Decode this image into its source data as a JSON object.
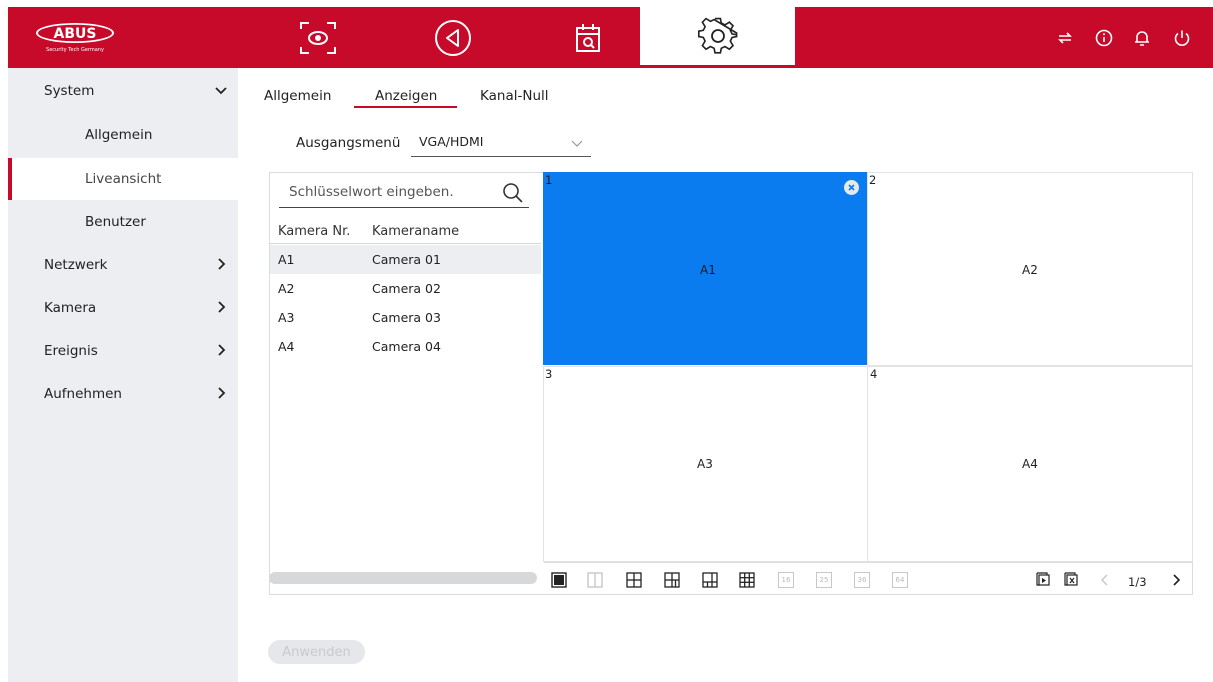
{
  "logo": {
    "brand": "ABUS",
    "tagline": "Security Tech Germany"
  },
  "topbar": {
    "icons": [
      "live-view-icon",
      "playback-icon",
      "schedule-search-icon",
      "settings-icon"
    ],
    "right_icons": [
      "swap-icon",
      "info-icon",
      "bell-icon",
      "power-icon"
    ]
  },
  "sidebar": {
    "items": [
      {
        "label": "System"
      },
      {
        "label": "Allgemein"
      },
      {
        "label": "Liveansicht"
      },
      {
        "label": "Benutzer"
      },
      {
        "label": "Netzwerk"
      },
      {
        "label": "Kamera"
      },
      {
        "label": "Ereignis"
      },
      {
        "label": "Aufnehmen"
      }
    ]
  },
  "tabs": [
    {
      "label": "Allgemein"
    },
    {
      "label": "Anzeigen"
    },
    {
      "label": "Kanal-Null"
    }
  ],
  "output": {
    "label": "Ausgangsmenü",
    "value": "VGA/HDMI"
  },
  "search": {
    "placeholder": "Schlüsselwort eingeben."
  },
  "camera_list": {
    "columns": [
      "Kamera Nr.",
      "Kameraname"
    ],
    "rows": [
      {
        "no": "A1",
        "name": "Camera 01"
      },
      {
        "no": "A2",
        "name": "Camera 02"
      },
      {
        "no": "A3",
        "name": "Camera 03"
      },
      {
        "no": "A4",
        "name": "Camera 04"
      }
    ]
  },
  "grid": {
    "cells": [
      {
        "num": "1",
        "cam": "A1"
      },
      {
        "num": "2",
        "cam": "A2"
      },
      {
        "num": "3",
        "cam": "A3"
      },
      {
        "num": "4",
        "cam": "A4"
      }
    ]
  },
  "layouts": [
    "16",
    "25",
    "36",
    "64"
  ],
  "pager": {
    "page": "1/3"
  },
  "apply": {
    "label": "Anwenden"
  },
  "colors": {
    "brand": "#c70a2a",
    "selected_cell": "#0a7cf0",
    "sidebar_bg": "#eceef1"
  }
}
